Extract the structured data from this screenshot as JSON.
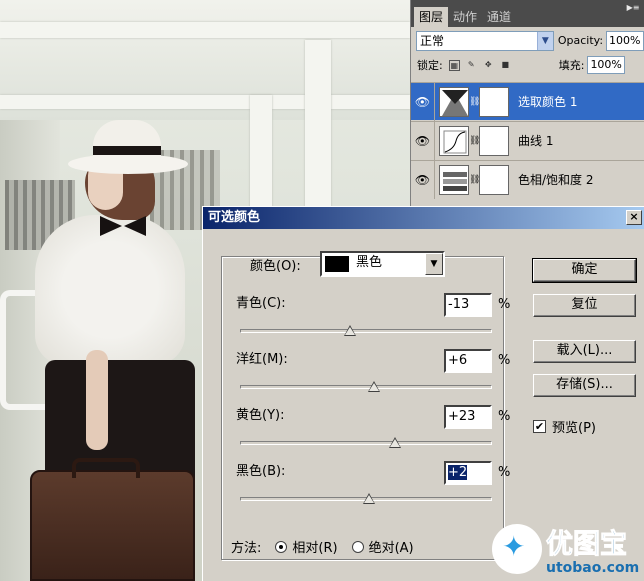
{
  "layers_panel": {
    "tabs": [
      "图层",
      "动作",
      "通道"
    ],
    "blend_mode": "正常",
    "opacity_label": "Opacity:",
    "opacity_value": "100%",
    "lock_label": "锁定:",
    "fill_label": "填充:",
    "fill_value": "100%",
    "layers": [
      {
        "name": "选取颜色 1",
        "selected": true
      },
      {
        "name": "曲线 1",
        "selected": false
      },
      {
        "name": "色相/饱和度 2",
        "selected": false
      }
    ]
  },
  "dialog": {
    "title": "可选颜色",
    "close_glyph": "×",
    "color_label": "颜色(O):",
    "color_value": "黑色",
    "swatch_color": "#000000",
    "sliders": [
      {
        "label": "青色(C):",
        "value": "-13",
        "unit": "%",
        "amount": -13
      },
      {
        "label": "洋红(M):",
        "value": "+6",
        "unit": "%",
        "amount": 6
      },
      {
        "label": "黄色(Y):",
        "value": "+23",
        "unit": "%",
        "amount": 23
      },
      {
        "label": "黑色(B):",
        "value": "+2",
        "unit": "%",
        "amount": 2
      }
    ],
    "buttons": {
      "ok": "确定",
      "reset": "复位",
      "load": "载入(L)...",
      "save": "存储(S)..."
    },
    "preview_label": "预览(P)",
    "preview_checked": true,
    "method_label": "方法:",
    "relative_label": "相对(R)",
    "absolute_label": "绝对(A)"
  },
  "watermark": {
    "text": "优图宝",
    "url": "utobao.com"
  },
  "colors": {
    "selection": "#316ac5",
    "title_start": "#0a246a",
    "title_end": "#a6caf0"
  }
}
